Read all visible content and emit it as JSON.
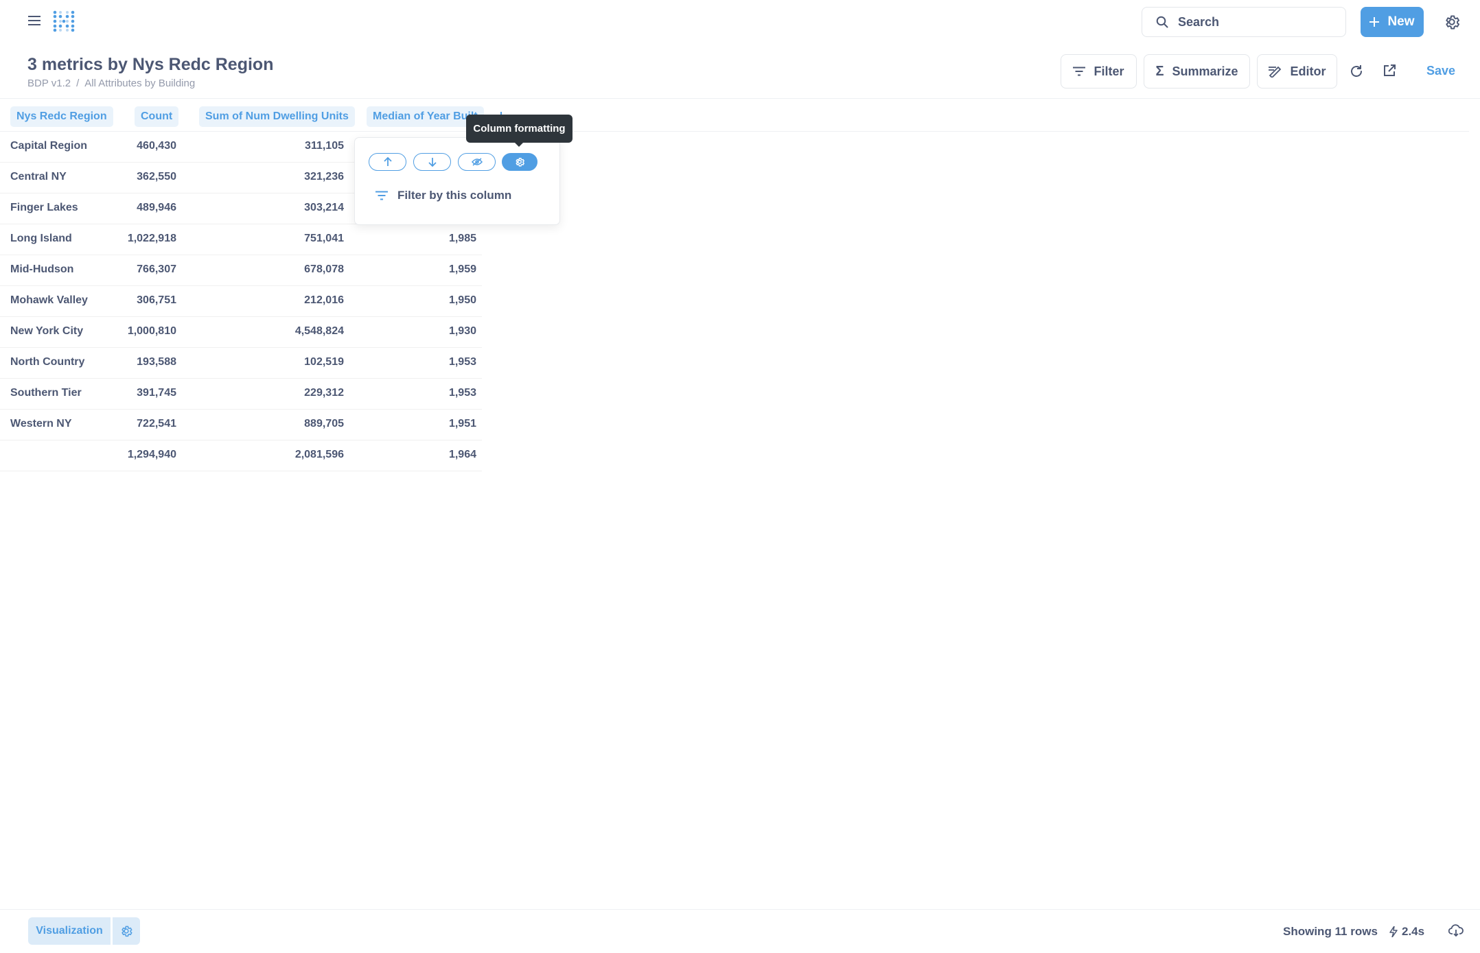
{
  "topbar": {
    "search_label": "Search",
    "new_label": "New"
  },
  "question": {
    "title": "3 metrics by Nys Redc Region",
    "breadcrumb": [
      "BDP v1.2",
      "/",
      "All Attributes by Building"
    ]
  },
  "actions": {
    "filter": "Filter",
    "summarize": "Summarize",
    "editor": "Editor",
    "save": "Save"
  },
  "table": {
    "columns": [
      "Nys Redc Region",
      "Count",
      "Sum of Num Dwelling Units",
      "Median of Year Built"
    ],
    "rows": [
      [
        "Capital Region",
        "460,430",
        "311,105",
        ""
      ],
      [
        "Central NY",
        "362,550",
        "321,236",
        ""
      ],
      [
        "Finger Lakes",
        "489,946",
        "303,214",
        ""
      ],
      [
        "Long Island",
        "1,022,918",
        "751,041",
        "1,985"
      ],
      [
        "Mid-Hudson",
        "766,307",
        "678,078",
        "1,959"
      ],
      [
        "Mohawk Valley",
        "306,751",
        "212,016",
        "1,950"
      ],
      [
        "New York City",
        "1,000,810",
        "4,548,824",
        "1,930"
      ],
      [
        "North Country",
        "193,588",
        "102,519",
        "1,953"
      ],
      [
        "Southern Tier",
        "391,745",
        "229,312",
        "1,953"
      ],
      [
        "Western NY",
        "722,541",
        "889,705",
        "1,951"
      ],
      [
        "",
        "1,294,940",
        "2,081,596",
        "1,964"
      ]
    ]
  },
  "popover": {
    "tooltip": "Column formatting",
    "filter_label": "Filter by this column",
    "icons": [
      "arrow-up-icon",
      "arrow-down-icon",
      "eye-off-icon",
      "gear-icon",
      "filter-icon"
    ]
  },
  "footer": {
    "visualization_label": "Visualization",
    "row_count": "Showing 11 rows",
    "timing": "2.4s"
  },
  "colors": {
    "accent": "#509ee3",
    "text": "#4c5773",
    "muted": "#949aab",
    "tooltip_bg": "#2e353b"
  }
}
